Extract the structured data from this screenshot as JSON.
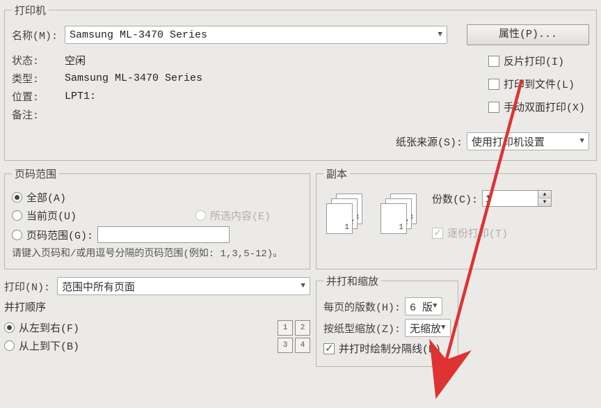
{
  "printer": {
    "legend": "打印机",
    "name_label": "名称(M):",
    "name_value": "Samsung ML-3470 Series",
    "properties_btn": "属性(P)...",
    "status_label": "状态:",
    "status_value": "空闲",
    "type_label": "类型:",
    "type_value": "Samsung ML-3470 Series",
    "where_label": "位置:",
    "where_value": "LPT1:",
    "comment_label": "备注:",
    "comment_value": "",
    "opt_mirror": "反片打印(I)",
    "opt_tofile": "打印到文件(L)",
    "opt_manual_duplex": "手动双面打印(X)",
    "source_label": "纸张来源(S):",
    "source_value": "使用打印机设置"
  },
  "range": {
    "legend": "页码范围",
    "all": "全部(A)",
    "current": "当前页(U)",
    "selection": "所选内容(E)",
    "pages": "页码范围(G):",
    "note": "请键入页码和/或用逗号分隔的页码范围(例如: 1,3,5-12)。"
  },
  "copies": {
    "legend": "副本",
    "count_label": "份数(C):",
    "count_value": "1",
    "collate": "逐份打印(T)"
  },
  "printwhat": {
    "label": "打印(N):",
    "value": "范围中所有页面"
  },
  "order": {
    "label": "并打顺序",
    "lr": "从左到右(F)",
    "tb": "从上到下(B)"
  },
  "collate_scale": {
    "legend": "并打和缩放",
    "perpage_label": "每页的版数(H):",
    "perpage_value": "6 版",
    "scale_label": "按纸型缩放(Z):",
    "scale_value": "无缩放",
    "draw_sep": "并打时绘制分隔线(D)"
  }
}
